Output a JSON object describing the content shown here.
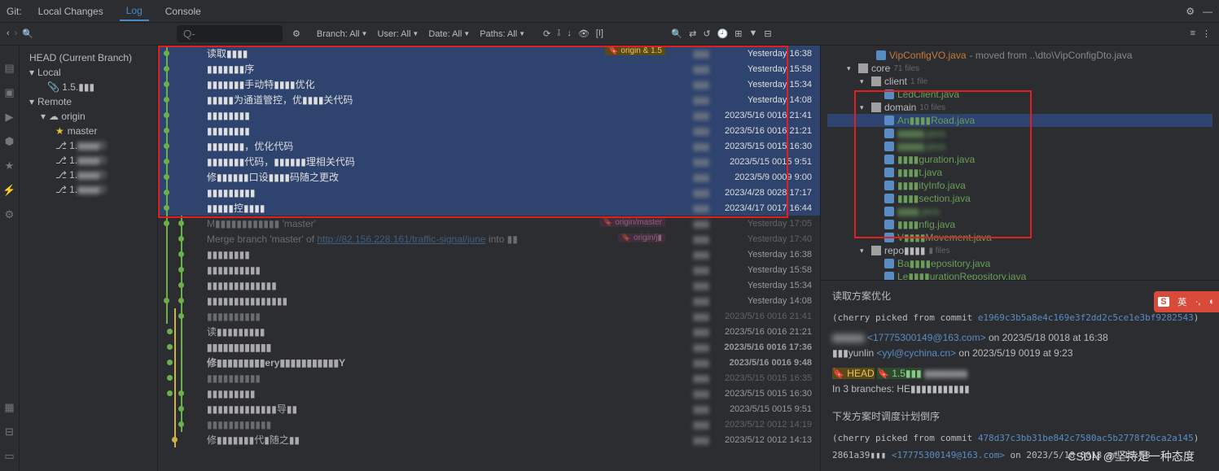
{
  "topbar": {
    "label": "Git:",
    "tabs": [
      "Local Changes",
      "Log",
      "Console"
    ],
    "active": 1
  },
  "filterbar": {
    "search_ph": "Q-",
    "filters": [
      {
        "k": "Branch",
        "v": "All"
      },
      {
        "k": "User",
        "v": "All"
      },
      {
        "k": "Date",
        "v": "All"
      },
      {
        "k": "Paths",
        "v": "All"
      }
    ]
  },
  "branches": {
    "head": "HEAD (Current Branch)",
    "local": {
      "label": "Local",
      "items": [
        "1.5."
      ]
    },
    "remote": {
      "label": "Remote",
      "origin": "origin",
      "items": [
        "master",
        "1.",
        "1.",
        "1.",
        "1."
      ]
    }
  },
  "commits": [
    {
      "sel": true,
      "dot": 10,
      "msg": "读取▮▮▮▮",
      "tags": [
        {
          "t": "origin & 1.5",
          "c": "yellow",
          "pos": "right"
        }
      ],
      "date": "Yesterday 16:38"
    },
    {
      "sel": true,
      "dot": 10,
      "msg": "▮▮▮▮▮▮▮序",
      "date": "Yesterday 15:58"
    },
    {
      "sel": true,
      "dot": 10,
      "msg": "▮▮▮▮▮▮▮手动特▮▮▮▮优化",
      "date": "Yesterday 15:34"
    },
    {
      "sel": true,
      "dot": 10,
      "msg": "▮▮▮▮▮为通道管控，优▮▮▮▮关代码",
      "date": "Yesterday 14:08"
    },
    {
      "sel": true,
      "dot": 10,
      "msg": "▮▮▮▮▮▮▮▮",
      "date": "2023/5/16 0016 21:41"
    },
    {
      "sel": true,
      "dot": 10,
      "msg": "▮▮▮▮▮▮▮▮",
      "date": "2023/5/16 0016 21:21"
    },
    {
      "sel": true,
      "dot": 10,
      "msg": "▮▮▮▮▮▮▮，优化代码",
      "date": "2023/5/15 0015 16:30"
    },
    {
      "sel": true,
      "dot": 10,
      "msg": "▮▮▮▮▮▮▮代码，▮▮▮▮▮▮理相关代码",
      "date": "2023/5/15 0015 9:51"
    },
    {
      "sel": true,
      "dot": 10,
      "msg": "修▮▮▮▮▮▮口设▮▮▮▮码随之更改",
      "date": "2023/5/9 0009 9:00"
    },
    {
      "sel": true,
      "dot": 10,
      "msg": "▮▮▮▮▮▮▮▮▮",
      "date": "2023/4/28 0028 17:17"
    },
    {
      "sel": true,
      "dot": 10,
      "msg": "▮▮▮▮▮控▮▮▮▮",
      "date": "2023/4/17 0017 16:44"
    },
    {
      "sel": false,
      "dot": 10,
      "dot2": 28,
      "msg": "M▮▮▮▮▮▮▮▮▮▮▮▮ 'master'",
      "tags": [
        {
          "t": "origin/master",
          "c": "pink",
          "pos": "right"
        }
      ],
      "date": "Yesterday 17:05",
      "dim": true
    },
    {
      "sel": false,
      "dot": 28,
      "msg": "Merge branch 'master' of ",
      "link": "http://82.156.228.161/traffic-signal/june",
      "linktail": " into ▮▮",
      "tags": [
        {
          "t": "origin/j▮",
          "c": "pink",
          "pos": "right"
        }
      ],
      "date": "Yesterday 17:40",
      "dim": true
    },
    {
      "sel": false,
      "dot": 28,
      "msg": "▮▮▮▮▮▮▮▮",
      "date": "Yesterday 16:38"
    },
    {
      "sel": false,
      "dot": 28,
      "msg": "▮▮▮▮▮▮▮▮▮▮",
      "date": "Yesterday 15:58"
    },
    {
      "sel": false,
      "dot": 28,
      "msg": "▮▮▮▮▮▮▮▮▮▮▮▮▮",
      "date": "Yesterday 15:34"
    },
    {
      "sel": false,
      "dot": 10,
      "dot2": 28,
      "msg": "▮▮▮▮▮▮▮▮▮▮▮▮▮▮▮",
      "date": "Yesterday 14:08"
    },
    {
      "sel": false,
      "dot": 28,
      "msg": "▮▮▮▮▮▮▮▮▮▮",
      "date": "2023/5/16 0016 21:41",
      "dim": true
    },
    {
      "sel": false,
      "dot": 14,
      "msg": "读▮▮▮▮▮▮▮▮▮",
      "date": "2023/5/16 0016 21:21"
    },
    {
      "sel": false,
      "dot": 14,
      "msg": "▮▮▮▮▮▮▮▮▮▮▮▮",
      "date": "2023/5/16 0016 17:36",
      "bold": true
    },
    {
      "sel": false,
      "dot": 14,
      "msg": "修▮▮▮▮▮▮▮▮▮ery▮▮▮▮▮▮▮▮▮▮▮Y",
      "date": "2023/5/16 0016 9:48",
      "bold": true
    },
    {
      "sel": false,
      "dot": 14,
      "msg": "▮▮▮▮▮▮▮▮▮▮",
      "date": "2023/5/15 0015 16:35",
      "dim": true
    },
    {
      "sel": false,
      "dot": 14,
      "dot2": 28,
      "msg": "▮▮▮▮▮▮▮▮▮",
      "date": "2023/5/15 0015 16:30"
    },
    {
      "sel": false,
      "dot": 28,
      "msg": "▮▮▮▮▮▮▮▮▮▮▮▮▮导▮▮",
      "date": "2023/5/15 0015 9:51"
    },
    {
      "sel": false,
      "dot": 28,
      "msg": "▮▮▮▮▮▮▮▮▮▮▮▮",
      "date": "2023/5/12 0012 14:19",
      "dim": true
    },
    {
      "sel": false,
      "dot": 20,
      "msg": "修▮▮▮▮▮▮▮代▮随之▮▮",
      "date": "2023/5/12 0012 14:13"
    }
  ],
  "files": {
    "header": {
      "name": "VipConfigVO.java",
      "tail": " - moved from ..\\dto\\VipConfigDto.java"
    },
    "tree": [
      {
        "ind": 1,
        "exp": true,
        "ico": "folder",
        "name": "core",
        "cnt": "71 files"
      },
      {
        "ind": 2,
        "exp": true,
        "ico": "folder",
        "name": "client",
        "cnt": "1 file"
      },
      {
        "ind": 3,
        "ico": "java",
        "name": "LedClient.java"
      },
      {
        "ind": 2,
        "exp": true,
        "ico": "folder",
        "name": "domain",
        "cnt": "10 files"
      },
      {
        "ind": 3,
        "ico": "java",
        "name": "An▮▮▮▮Road.java",
        "sel": true
      },
      {
        "ind": 3,
        "ico": "java",
        "name": "▮▮▮▮▮.java",
        "blur": true
      },
      {
        "ind": 3,
        "ico": "java",
        "name": "▮▮▮▮▮.java",
        "blur": true
      },
      {
        "ind": 3,
        "ico": "java",
        "name": "▮▮▮▮guration.java"
      },
      {
        "ind": 3,
        "ico": "java",
        "name": "▮▮▮▮t.java"
      },
      {
        "ind": 3,
        "ico": "java",
        "name": "▮▮▮▮ityInfo.java"
      },
      {
        "ind": 3,
        "ico": "java",
        "name": "▮▮▮▮section.java"
      },
      {
        "ind": 3,
        "ico": "java",
        "name": "▮▮▮▮.java",
        "blur": true
      },
      {
        "ind": 3,
        "ico": "java",
        "name": "▮▮▮▮nfig.java"
      },
      {
        "ind": 3,
        "ico": "java",
        "name": "V▮▮▮▮Movement.java"
      },
      {
        "ind": 2,
        "exp": true,
        "ico": "folder",
        "name": "repo▮▮▮▮",
        "cnt": "▮ files"
      },
      {
        "ind": 3,
        "ico": "java",
        "name": "Ba▮▮▮▮epository.java"
      },
      {
        "ind": 3,
        "ico": "java",
        "name": "Le▮▮▮▮urationRepository.java"
      }
    ]
  },
  "detail": {
    "title1": "读取方案优化",
    "cherry1a": "(cherry picked from commit ",
    "cherry1b": "e1969c3b5a8e4c169e3f2dd2c5ce1e3bf9282543",
    "cherry1c": ")",
    "author1a": "<17775300149@163.com>",
    "author1b": " on 2023/5/18 0018 at 16:38",
    "author2a": "▮▮▮yunlin ",
    "author2b": "<yyl@cychina.cn>",
    "author2c": " on 2023/5/19 0019 at 9:23",
    "tag_head": "HEAD",
    "tag_15": "1.5▮▮▮",
    "branches": "In 3 branches: HE▮▮▮▮▮▮▮▮▮▮▮",
    "title2": "下发方案时调度计划倒序",
    "cherry2a": "(cherry picked from commit ",
    "cherry2b": "478d37c3bb31be842c7580ac5b2778f26ca2a145",
    "cherry2c": ")",
    "foot_hash": "2861a39▮▮▮",
    "foot_mail": "<17775300149@163.com>",
    "foot_date": " on 2023/5/18 0018 at 15:58"
  },
  "watermark": "CSDN @坚持是一种态度",
  "ime": {
    "a": "S",
    "b": "英",
    "c": "·,",
    "d": "◐"
  }
}
